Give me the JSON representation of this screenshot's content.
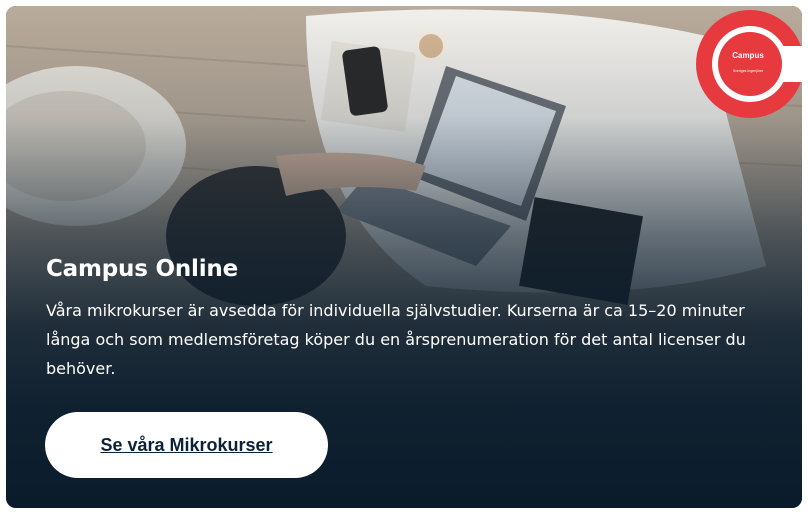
{
  "card": {
    "title": "Campus Online",
    "description": "Våra mikrokurser är avsedda för individuella självstudier. Kurserna är ca 15–20 minuter långa och som medlemsföretag köper du en årsprenumeration för det antal licenser du behöver.",
    "cta_label": "Se våra Mikrokurser"
  },
  "logo": {
    "text": "Campus",
    "subtext": "Sveriges Ingenjörer",
    "color": "#e63a3f"
  },
  "colors": {
    "overlay": "#0a1c2c",
    "button_bg": "#ffffff",
    "button_text": "#0b2236",
    "text": "#ffffff"
  }
}
